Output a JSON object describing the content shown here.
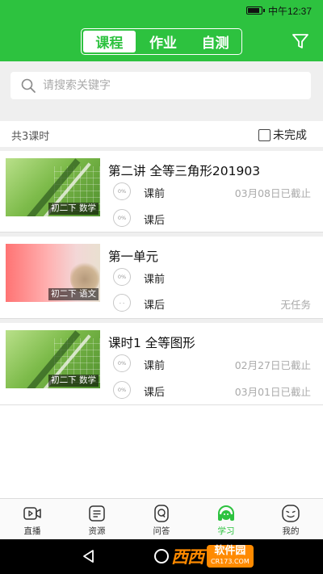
{
  "status_bar": {
    "time": "中午12:37"
  },
  "header": {
    "tabs": [
      {
        "label": "课程",
        "active": true
      },
      {
        "label": "作业",
        "active": false
      },
      {
        "label": "自测",
        "active": false
      }
    ],
    "filter_icon": "filter-icon"
  },
  "search": {
    "placeholder": "请搜索关键字"
  },
  "summary": {
    "count_text": "共3课时",
    "incomplete_label": "未完成",
    "incomplete_checked": false
  },
  "courses": [
    {
      "title": "第二讲  全等三角形201903",
      "tag": "初二下 数学",
      "tasks": [
        {
          "progress": "0%",
          "label": "课前",
          "status": "03月08日已截止"
        },
        {
          "progress": "0%",
          "label": "课后",
          "status": ""
        }
      ]
    },
    {
      "title": "第一单元",
      "tag": "初二下 语文",
      "tasks": [
        {
          "progress": "0%",
          "label": "课前",
          "status": ""
        },
        {
          "progress": "- -",
          "label": "课后",
          "status": "无任务"
        }
      ]
    },
    {
      "title": "课时1 全等图形",
      "tag": "初二下 数学",
      "tasks": [
        {
          "progress": "0%",
          "label": "课前",
          "status": "02月27日已截止"
        },
        {
          "progress": "0%",
          "label": "课后",
          "status": "03月01日已截止"
        }
      ]
    }
  ],
  "tabbar": [
    {
      "label": "直播",
      "icon": "video-icon",
      "active": false
    },
    {
      "label": "资源",
      "icon": "document-icon",
      "active": false
    },
    {
      "label": "问答",
      "icon": "question-icon",
      "active": false
    },
    {
      "label": "学习",
      "icon": "headphones-icon",
      "active": true
    },
    {
      "label": "我的",
      "icon": "face-icon",
      "active": false
    }
  ],
  "watermark": {
    "logo": "西西",
    "name": "软件园",
    "domain": "CR173.COM"
  },
  "colors": {
    "accent": "#2dc23f",
    "muted": "#aaaaaa"
  }
}
